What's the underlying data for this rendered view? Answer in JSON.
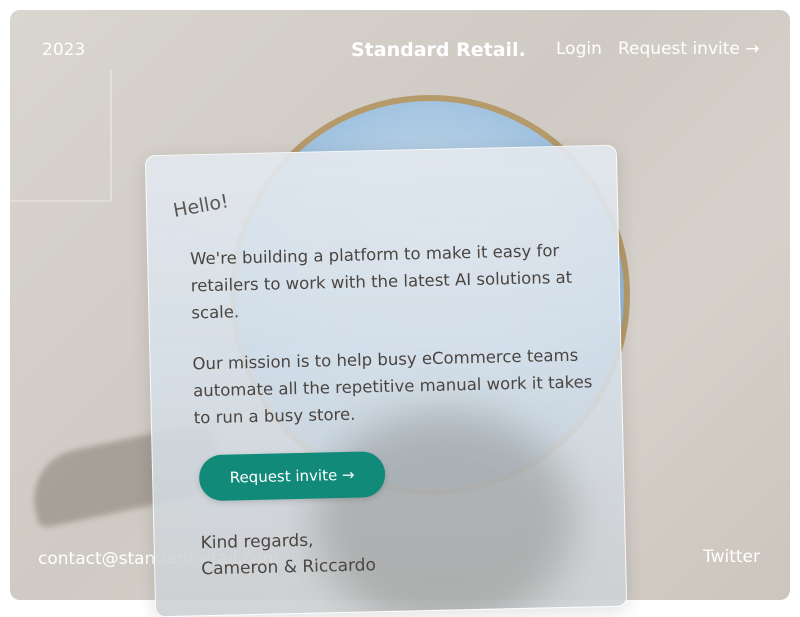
{
  "nav": {
    "year": "2023",
    "brand": "Standard Retail.",
    "login": "Login",
    "request_invite": "Request invite →"
  },
  "card": {
    "greeting": "Hello!",
    "paragraph_1": "We're building a platform to make it easy for retailers to work with the latest AI solutions at scale.",
    "paragraph_2": "Our mission is to help busy eCommerce teams automate all the repetitive manual work it takes to run a busy store.",
    "cta_label": "Request invite →",
    "signoff_1": "Kind regards,",
    "signoff_2": "Cameron & Riccardo"
  },
  "footer": {
    "email": "contact@standardretail.com",
    "twitter": "Twitter"
  },
  "colors": {
    "accent": "#128a7a",
    "text_light": "#ffffff",
    "text_dark": "#4a4540"
  }
}
